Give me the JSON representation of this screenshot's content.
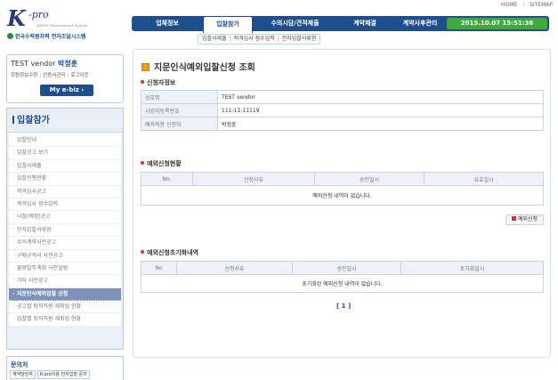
{
  "util_links": [
    "HOME",
    "SITEMAP"
  ],
  "logo": {
    "k": "K",
    "pro": "-pro",
    "sub": "KHNP Procurement System",
    "org": "한국수력원자력 전자조달시스템"
  },
  "nav": {
    "items": [
      "업체정보",
      "입찰참가",
      "수의시담/견적제출",
      "계약체결",
      "계약사후관리"
    ],
    "active_index": 1,
    "clock": "2015.10.07 15:51:36"
  },
  "subnav": [
    "입찰서제출",
    "적격심사 점수입력",
    "전자입찰서류함"
  ],
  "user": {
    "name": "TEST vendor",
    "person": "박정훈",
    "links": [
      "회원정보수정",
      "인증서관리",
      "로그아웃"
    ],
    "ebiz_label": "My e-biz"
  },
  "sidebar": {
    "title": "입찰참가",
    "items": [
      "입찰안내",
      "입찰공고 보기",
      "입찰서제출",
      "입찰진행현황",
      "적격심사공고",
      "적격심사 점수입력",
      "낙찰(예정)공고",
      "전자입찰서류함",
      "수의계약사전공고",
      "구매규격서 사전공고",
      "물량발주계획 사전알림",
      "기타 사전공고",
      "지문인식예외입찰 신청",
      "공고별 퇴직직원 재취업 현황",
      "입찰별 퇴직직원 재취업 현황"
    ],
    "active_index": 12
  },
  "contact": {
    "title": "문의처",
    "tabs": [
      "계약담당자",
      "K-pro이용 전자입찰 문의"
    ]
  },
  "main": {
    "title": "지문인식예외입찰신청 조회",
    "applicant_section": "신청자정보",
    "applicant": [
      {
        "label": "상호명",
        "value": "TEST vendor"
      },
      {
        "label": "사업자등록번호",
        "value": "111-11-11119"
      },
      {
        "label": "예외적용 신청자",
        "value": "박정훈"
      }
    ],
    "status_section": "예외신청현황",
    "status_headers": [
      "No.",
      "신청사유",
      "승인일시",
      "유효일시"
    ],
    "status_empty": "예외신청 내역이 없습니다.",
    "apply_button": "예외신청",
    "reset_section": "예외신청초기화내역",
    "reset_headers": [
      "No",
      "신청사유",
      "승인일시",
      "초기화일시"
    ],
    "reset_empty": "초기화된 예외신청 내역이 없습니다.",
    "pager": "[ 1 ]"
  }
}
